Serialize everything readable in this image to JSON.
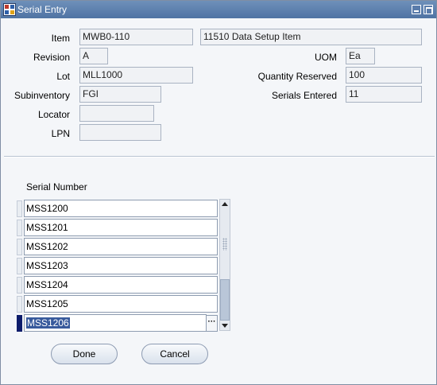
{
  "window": {
    "title": "Serial Entry",
    "accent": "#5a7cab"
  },
  "labels": {
    "item": "Item",
    "revision": "Revision",
    "lot": "Lot",
    "subinventory": "Subinventory",
    "locator": "Locator",
    "lpn": "LPN",
    "uom": "UOM",
    "quantity_reserved": "Quantity Reserved",
    "serials_entered": "Serials Entered"
  },
  "values": {
    "item": "MWB0-110",
    "item_description": "11510 Data Setup Item",
    "revision": "A",
    "lot": "MLL1000",
    "subinventory": "FGI",
    "locator": "",
    "lpn": "",
    "uom": "Ea",
    "quantity_reserved": "100",
    "serials_entered": "11"
  },
  "serial_table": {
    "header": "Serial Number",
    "rows": [
      "MSS1200",
      "MSS1201",
      "MSS1202",
      "MSS1203",
      "MSS1204",
      "MSS1205",
      "MSS1206"
    ],
    "active_row": 6
  },
  "buttons": {
    "done": "Done",
    "cancel": "Cancel"
  },
  "icons": {
    "lov": "ellipsis-icon"
  }
}
